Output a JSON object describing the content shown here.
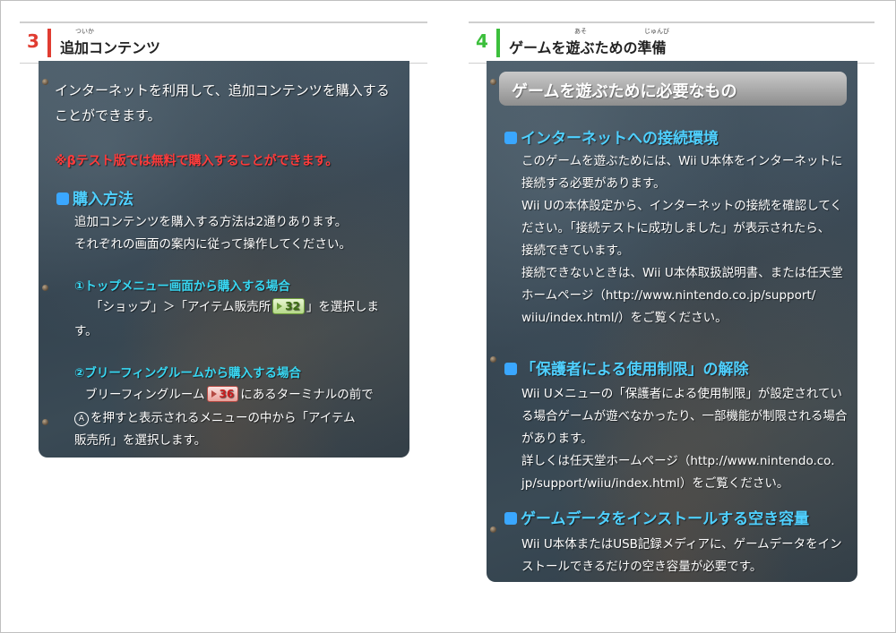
{
  "left_page": {
    "number": "3",
    "accent": "#e03c31",
    "title": "追加コンテンツ",
    "title_ruby": "ついか",
    "intro": [
      "インターネットを利用して、追加コンテンツを購入する",
      "ことができます。"
    ],
    "notice": "※βテスト版では無料で購入することができます。",
    "section_heading": "購入方法",
    "section_lines": [
      "追加コンテンツを購入する方法は2通りあります。",
      "それぞれの画面の案内に従って操作してください。"
    ],
    "method1_heading": "①トップメニュー画面から購入する場合",
    "method1_text_a": "「ショップ」＞「アイテム販売所",
    "method1_badge": "32",
    "method1_text_b": "」を選択しま",
    "method1_text_c": "す。",
    "method2_heading": "②ブリーフィングルームから購入する場合",
    "method2_text_a": "ブリーフィングルーム",
    "method2_badge": "36",
    "method2_text_b": "にあるターミナルの前で",
    "method2_button": "A",
    "method2_text_c": "を押すと表示されるメニューの中から「アイテム",
    "method2_text_d": "販売所」を選択します。"
  },
  "right_page": {
    "number": "4",
    "accent": "#3cbf3c",
    "title": "ゲームを遊ぶための準備",
    "title_ruby_a": "あそ",
    "title_ruby_b": "じゅんび",
    "box_title": "ゲームを遊ぶために必要なもの",
    "s1_heading": "インターネットへの接続環境",
    "s1_lines": [
      "このゲームを遊ぶためには、Wii U本体をインターネットに",
      "接続する必要があります。",
      "Wii Uの本体設定から、インターネットの接続を確認してく",
      "ださい。「接続テストに成功しました」が表示されたら、",
      "接続できています。",
      "接続できないときは、Wii U本体取扱説明書、または任天堂",
      "ホームページ（http://www.nintendo.co.jp/support/",
      "wiiu/index.html/）をご覧ください。"
    ],
    "s2_heading": "「保護者による使用制限」の解除",
    "s2_lines": [
      "Wii Uメニューの「保護者による使用制限」が設定されてい",
      "る場合ゲームが遊べなかったり、一部機能が制限される場合",
      "があります。",
      "詳しくは任天堂ホームページ（http://www.nintendo.co.",
      "jp/support/wiiu/index.html）をご覧ください。"
    ],
    "s3_heading": "ゲームデータをインストールする空き容量",
    "s3_lines": [
      "Wii U本体またはUSB記録メディアに、ゲームデータをイン",
      "ストールできるだけの空き容量が必要です。"
    ]
  }
}
